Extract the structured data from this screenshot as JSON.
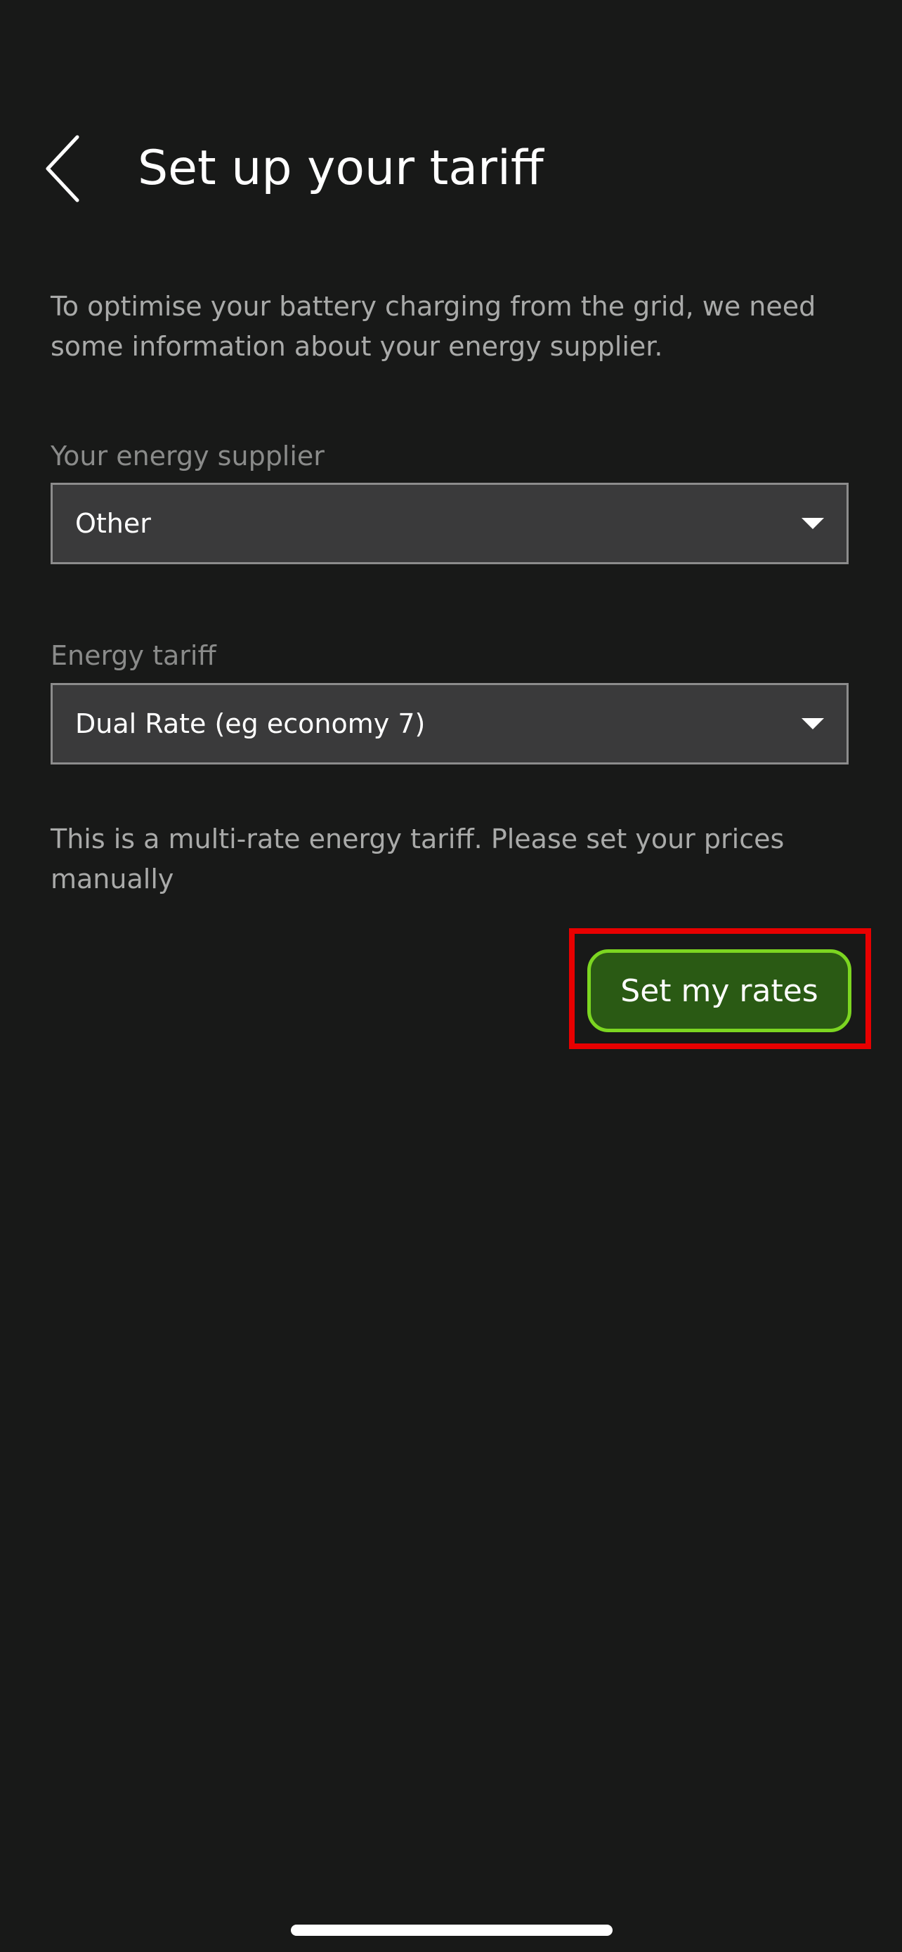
{
  "header": {
    "title": "Set up your tariff",
    "back_icon": "chevron-left-icon"
  },
  "intro": {
    "text": "To optimise your battery charging from the grid, we need some information about your energy supplier."
  },
  "supplier_field": {
    "label": "Your energy supplier",
    "value": "Other",
    "icon": "caret-down-icon"
  },
  "tariff_field": {
    "label": "Energy tariff",
    "value": "Dual Rate (eg economy 7)",
    "icon": "caret-down-icon"
  },
  "note": {
    "text": "This is a multi-rate energy tariff. Please set your prices manually"
  },
  "actions": {
    "set_rates_label": "Set my rates"
  },
  "colors": {
    "background": "#181918",
    "button_fill": "#2a5a14",
    "button_border": "#7cd621",
    "highlight": "#e80000",
    "select_fill": "#3a3a3b"
  }
}
